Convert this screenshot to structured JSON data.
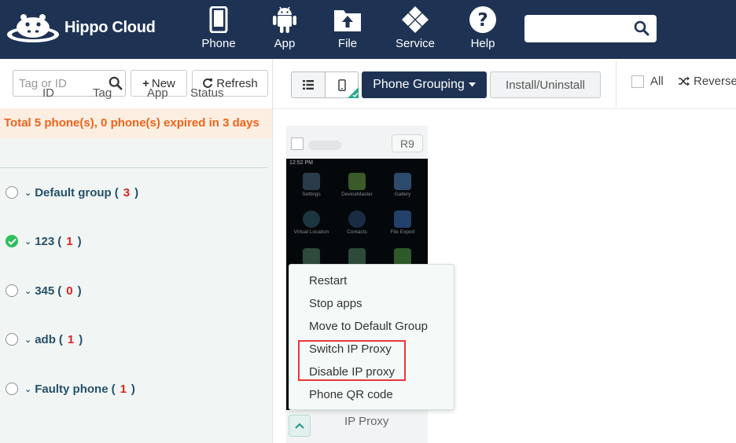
{
  "app": {
    "name": "Hippo Cloud"
  },
  "nav": [
    {
      "label": "Phone",
      "icon": "phone-icon"
    },
    {
      "label": "App",
      "icon": "android-icon"
    },
    {
      "label": "File",
      "icon": "file-upload-icon"
    },
    {
      "label": "Service",
      "icon": "service-icon"
    },
    {
      "label": "Help",
      "icon": "help-icon"
    }
  ],
  "top_search": {
    "value": "",
    "placeholder": ""
  },
  "left": {
    "search_placeholder": "Tag or ID",
    "new_label": "New",
    "refresh_label": "Refresh",
    "summary": "Total 5 phone(s), 0 phone(s) expired in 3 days",
    "columns": [
      "ID",
      "Tag",
      "App",
      "Status"
    ],
    "groups": [
      {
        "name": "Default group",
        "count": "3",
        "checked": false
      },
      {
        "name": "123",
        "count": "1",
        "checked": true
      },
      {
        "name": "345",
        "count": "0",
        "checked": false
      },
      {
        "name": "adb",
        "count": "1",
        "checked": false
      },
      {
        "name": "Faulty phone",
        "count": "1",
        "checked": false
      }
    ]
  },
  "toolbar": {
    "grouping_label": "Phone Grouping",
    "install_label": "Install/Uninstall",
    "all_label": "All",
    "reverse_label": "Reverse"
  },
  "phone_card": {
    "model": "R9",
    "status_time": "12:52 PM",
    "apps": [
      "Settings",
      "DeviceMaster",
      "Gallery",
      "Virtual Location",
      "Contacts",
      "File Export"
    ],
    "footer_label": "IP Proxy"
  },
  "context_menu": {
    "items": [
      "Restart",
      "Stop apps",
      "Move to Default Group",
      "Switch IP Proxy",
      "Disable IP proxy",
      "Phone QR code"
    ]
  },
  "colors": {
    "header_bg": "#1e3354",
    "summary_text": "#f0631a",
    "count_red": "#e02020",
    "highlight_box": "#e8383b",
    "check_green": "#2fbf5c"
  }
}
